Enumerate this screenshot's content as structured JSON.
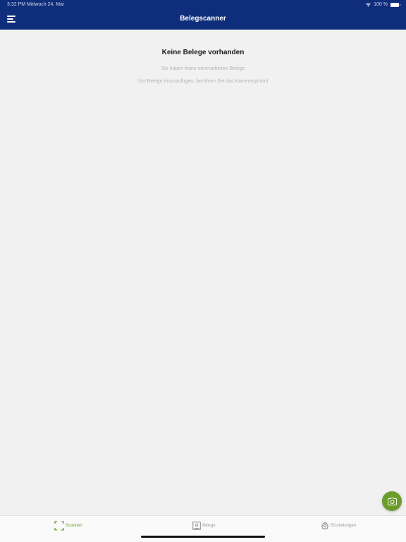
{
  "status_bar": {
    "time": "3:32 PM  Mittwoch 24. Mai",
    "battery": "100 %"
  },
  "header": {
    "title": "Belegscanner",
    "menu_icon": "hamburger-menu-icon"
  },
  "empty_state": {
    "title": "Keine Belege vorhanden",
    "message1": "Sie haben keine unverarbeiten Belege",
    "message2": "Um Belege hinzuzufügen, berühren Sie das Kamerasymbol"
  },
  "fab": {
    "icon": "camera-icon"
  },
  "tabs": [
    {
      "label": "Scannen",
      "icon": "scan-frame-icon",
      "active": true
    },
    {
      "label": "Belege",
      "icon": "receipt-icon",
      "active": false
    },
    {
      "label": "Einstellungen",
      "icon": "gear-icon",
      "active": false
    }
  ],
  "colors": {
    "header_bg": "#0e2e7c",
    "accent": "#6a9c2a",
    "background": "#f1f1f1"
  }
}
